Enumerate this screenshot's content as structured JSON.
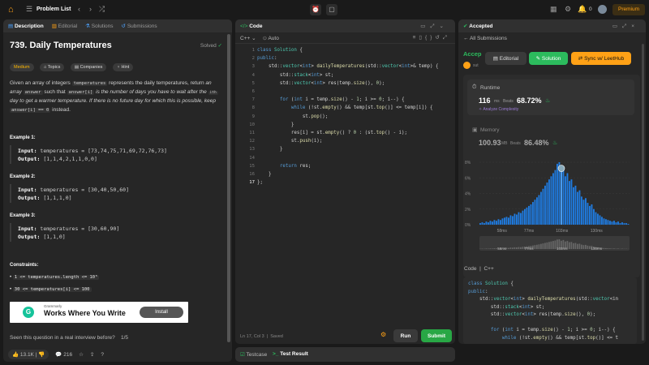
{
  "topbar": {
    "title": "Problem List",
    "premium": "Premium",
    "count": "0"
  },
  "left": {
    "tabs": [
      "Description",
      "Editorial",
      "Solutions",
      "Submissions"
    ],
    "title": "739. Daily Temperatures",
    "solved": "Solved",
    "tags": [
      "Medium",
      "Topics",
      "Companies",
      "Hint"
    ],
    "desc": {
      "p1": "Given an array of integers",
      "c1": "temperatures",
      "p2": "represents the daily temperatures, return",
      "p3": "an array",
      "c2": "answer",
      "p4": "such that",
      "c3": "answer[i]",
      "p5": "is the number of days you have to wait after the",
      "sup": "ith",
      "p6": "day to get a warmer temperature. If there is no future day for which this is possible, keep",
      "c4": "answer[i] == 0",
      "p7": "instead."
    },
    "examples": [
      {
        "label": "Example 1:",
        "input": "temperatures = [73,74,75,71,69,72,76,73]",
        "output": "[1,1,4,2,1,1,0,0]"
      },
      {
        "label": "Example 2:",
        "input": "temperatures = [30,40,50,60]",
        "output": "[1,1,1,0]"
      },
      {
        "label": "Example 3:",
        "input": "temperatures = [30,60,90]",
        "output": "[1,1,0]"
      }
    ],
    "input_label": "Input:",
    "output_label": "Output:",
    "constraints_label": "Constraints:",
    "constraints": [
      "1 <= temperatures.length <= 10⁵",
      "30 <= temperatures[i] <= 100"
    ],
    "ad": {
      "brand": "Grammarly",
      "headline": "Works Where You Write",
      "button": "Install"
    },
    "interview": "Seen this question in a real interview before?",
    "interview_count": "1/5",
    "likes": "13.1K",
    "comments": "216"
  },
  "code": {
    "tab": "Code",
    "lang": "C++",
    "auto": "Auto",
    "status": "Ln 17, Col 3",
    "saved": "Saved",
    "run": "Run",
    "submit": "Submit",
    "lines": [
      "class Solution {",
      "public:",
      "    std::vector<int> dailyTemperatures(std::vector<int>& temp) {",
      "        std::stack<int> st;",
      "        std::vector<int> res(temp.size(), 0);",
      "",
      "        for (int i = temp.size() - 1; i >= 0; i--) {",
      "            while (!st.empty() && temp[st.top()] <= temp[i]) {",
      "                st.pop();",
      "            }",
      "            res[i] = st.empty() ? 0 : (st.top() - i);",
      "            st.push(i);",
      "        }",
      "",
      "        return res;",
      "    }",
      "};"
    ]
  },
  "bottom": {
    "testcase": "Testcase",
    "result": "Test Result"
  },
  "right": {
    "tab": "Accepted",
    "all": "All Submissions",
    "accepted": "Accep",
    "user": "sut",
    "editorial": "Editorial",
    "solution": "Solution",
    "sync": "Sync w/ LeetHub",
    "runtime": {
      "label": "Runtime",
      "value": "116",
      "unit": "ms",
      "beats_label": "Beats",
      "beats": "68.72%",
      "analyze": "Analyze Complexity"
    },
    "memory": {
      "label": "Memory",
      "value": "100.93",
      "unit": "MB",
      "beats_label": "Beats",
      "beats": "86.48%"
    },
    "code_label": "Code",
    "code_lang": "C++",
    "code_lines": [
      "class Solution {",
      "public:",
      "    std::vector<int> dailyTemperatures(std::vector<in",
      "        std::stack<int> st;",
      "        std::vector<int> res(temp.size(), 0);",
      "",
      "        for (int i = temp.size() - 1; i >= 0; i--) {",
      "            while (!st.empty() && temp[st.top()] <= t"
    ]
  },
  "chart_data": {
    "type": "bar",
    "title": "",
    "xlabel": "",
    "ylabel": "",
    "y_ticks": [
      "8%",
      "6%",
      "4%",
      "2%",
      "0%"
    ],
    "x_ticks": [
      "58ms",
      "77ms",
      "103ms",
      "130ms"
    ],
    "mini_x_ticks": [
      "58ms",
      "77ms",
      "103ms",
      "130ms"
    ],
    "values": [
      0.2,
      0.3,
      0.2,
      0.4,
      0.3,
      0.5,
      0.4,
      0.6,
      0.5,
      0.7,
      0.6,
      0.8,
      0.9,
      1.0,
      0.9,
      1.2,
      1.1,
      1.4,
      1.3,
      1.6,
      1.5,
      1.8,
      2.0,
      2.2,
      2.4,
      2.6,
      2.9,
      3.2,
      3.5,
      3.8,
      4.2,
      4.6,
      5.0,
      5.4,
      5.8,
      6.2,
      6.6,
      7.0,
      7.8,
      8.0,
      6.8,
      7.4,
      6.2,
      6.6,
      5.6,
      5.8,
      4.8,
      5.0,
      4.2,
      4.4,
      3.6,
      3.2,
      3.4,
      2.8,
      2.4,
      2.6,
      2.0,
      1.6,
      1.4,
      1.2,
      1.0,
      0.8,
      0.7,
      0.6,
      0.5,
      0.4,
      0.5,
      0.3,
      0.4,
      0.2,
      0.3,
      0.2,
      0.2,
      0.1
    ],
    "ylim": [
      0,
      8
    ],
    "highlight_index": 40
  }
}
